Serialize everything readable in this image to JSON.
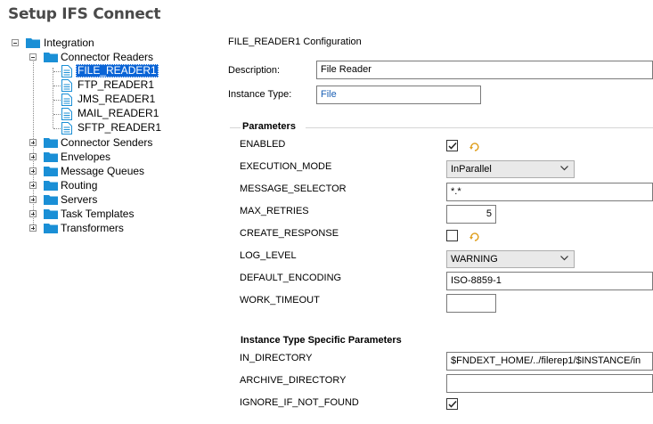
{
  "window": {
    "title": "Setup IFS Connect"
  },
  "tree": {
    "root": "Integration",
    "connector_readers": {
      "label": "Connector Readers",
      "children": [
        "FILE_READER1",
        "FTP_READER1",
        "JMS_READER1",
        "MAIL_READER1",
        "SFTP_READER1"
      ],
      "selected": "FILE_READER1"
    },
    "others": [
      "Connector Senders",
      "Envelopes",
      "Message Queues",
      "Routing",
      "Servers",
      "Task Templates",
      "Transformers"
    ]
  },
  "config": {
    "title": "FILE_READER1 Configuration",
    "description_label": "Description:",
    "description_value": "File Reader",
    "instance_type_label": "Instance Type:",
    "instance_type_value": "File"
  },
  "parameters": {
    "title": "Parameters",
    "enabled": {
      "label": "ENABLED",
      "checked": true
    },
    "execution_mode": {
      "label": "EXECUTION_MODE",
      "value": "InParallel"
    },
    "message_selector": {
      "label": "MESSAGE_SELECTOR",
      "value": "*.*"
    },
    "max_retries": {
      "label": "MAX_RETRIES",
      "value": "5"
    },
    "create_response": {
      "label": "CREATE_RESPONSE",
      "checked": false
    },
    "log_level": {
      "label": "LOG_LEVEL",
      "value": "WARNING"
    },
    "default_encoding": {
      "label": "DEFAULT_ENCODING",
      "value": "ISO-8859-1"
    },
    "work_timeout": {
      "label": "WORK_TIMEOUT",
      "value": ""
    }
  },
  "instance_params": {
    "title": "Instance Type Specific Parameters",
    "in_directory": {
      "label": "IN_DIRECTORY",
      "value": "$FNDEXT_HOME/../filerep1/$INSTANCE/in"
    },
    "archive_directory": {
      "label": "ARCHIVE_DIRECTORY",
      "value": ""
    },
    "ignore_if_not_found": {
      "label": "IGNORE_IF_NOT_FOUND",
      "checked": true
    }
  },
  "colors": {
    "folder": "#1a8fd6",
    "selection": "#0a64d6",
    "undo": "#e0a020",
    "title": "#4a4a4a"
  },
  "icons": [
    "folder-icon",
    "document-icon",
    "undo-icon",
    "checkmark-icon",
    "chevron-down-icon"
  ]
}
